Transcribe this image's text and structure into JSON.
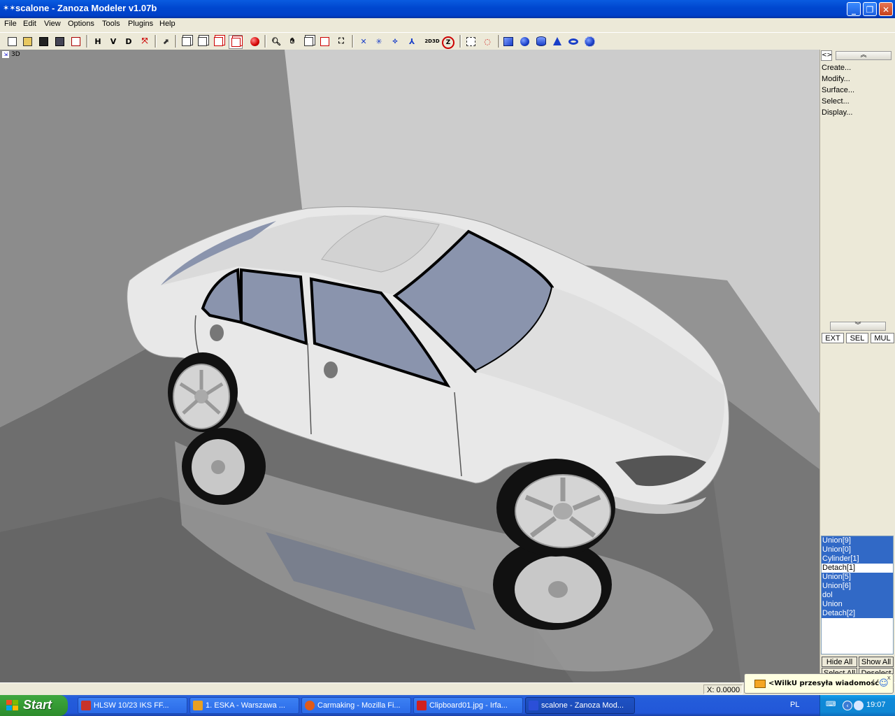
{
  "window": {
    "title": "scalone - Zanoza Modeler v1.07b",
    "minimize": "_",
    "restore": "❐",
    "close": "✕"
  },
  "menu": [
    "File",
    "Edit",
    "View",
    "Options",
    "Tools",
    "Plugins",
    "Help"
  ],
  "toolbar": {
    "h_label": "H",
    "v_label": "V",
    "d_label": "D",
    "twod3d_label": "2D3D",
    "z_label": "Z"
  },
  "viewport": {
    "label": "3D",
    "background": "#D6D6D6",
    "car_color": "#E6E6E6",
    "glass_color": "#8A94AD"
  },
  "right_panel": {
    "toggle": "<>",
    "up_arrow": "︽",
    "down_arrow": "︾",
    "menu": [
      "Create...",
      "Modify...",
      "Surface...",
      "Select...",
      "Display..."
    ],
    "mode_buttons": [
      "EXT",
      "SEL",
      "MUL"
    ]
  },
  "objects": [
    {
      "name": "Union[9]",
      "selected": true
    },
    {
      "name": "Union[0]",
      "selected": true
    },
    {
      "name": "Cylinder[1]",
      "selected": true
    },
    {
      "name": "Detach[1]",
      "selected": false
    },
    {
      "name": "Union[5]",
      "selected": true
    },
    {
      "name": "Union[6]",
      "selected": true
    },
    {
      "name": "dol",
      "selected": true
    },
    {
      "name": "Union",
      "selected": true
    },
    {
      "name": "Detach[2]",
      "selected": true
    }
  ],
  "list_buttons": {
    "hide_all": "Hide All",
    "show_all": "Show All",
    "select_all": "Select All",
    "deselect": "Deselect"
  },
  "status": {
    "coord_x": "X: 0.0000"
  },
  "notification": {
    "text": "<WilkU przesyła wiadomość",
    "close": "x"
  },
  "taskbar": {
    "start": "Start",
    "tasks": [
      {
        "label": "HLSW   10/23 IKS FF...",
        "icon_color": "#C8332A",
        "active": false
      },
      {
        "label": "1. ESKA - Warszawa ...",
        "icon_color": "#E8A020",
        "active": false
      },
      {
        "label": "Carmaking - Mozilla Fi...",
        "icon_color": "#E05A1A",
        "active": false
      },
      {
        "label": "Clipboard01.jpg - Irfa...",
        "icon_color": "#D02020",
        "active": false
      },
      {
        "label": "scalone - Zanoza Mod...",
        "icon_color": "#2B4FD8",
        "active": true
      }
    ],
    "lang": "PL",
    "clock": "19:07"
  }
}
